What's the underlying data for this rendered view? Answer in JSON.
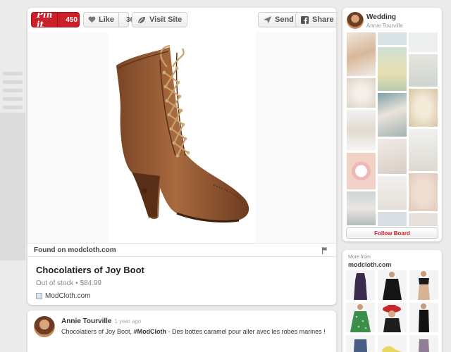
{
  "toolbar": {
    "pin_label": "Pin it",
    "pin_count": "450",
    "like_label": "Like",
    "like_count": "36",
    "visit_label": "Visit Site",
    "send_label": "Send",
    "share_label": "Share"
  },
  "pin": {
    "found_on": "Found on modcloth.com",
    "title": "Chocolatiers of Joy Boot",
    "price_line": "Out of stock • $84.99",
    "source": "ModCloth.com"
  },
  "comment": {
    "author": "Annie Tourville",
    "time": "1 year ago",
    "text_before": "Chocolatiers of Joy Boot, ",
    "hashtag": "#ModCloth",
    "text_after": " - Des bottes caramel pour aller avec les robes marines !"
  },
  "board": {
    "title": "Wedding",
    "owner": "Annie Tourville",
    "follow_label": "Follow Board"
  },
  "more": {
    "label": "More from",
    "source": "modcloth.com"
  },
  "colors": {
    "pinterest_red": "#cb2027",
    "boot_brown": "#8b5330",
    "lace_tan": "#c9a06a"
  },
  "icons": [
    "heart-icon",
    "leaf-icon",
    "send-icon",
    "facebook-icon",
    "flag-icon",
    "favicon-icon"
  ]
}
